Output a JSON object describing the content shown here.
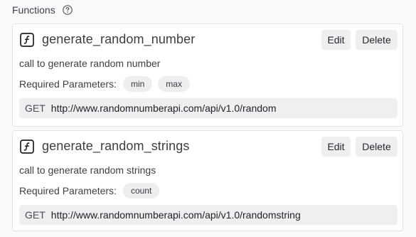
{
  "section": {
    "title": "Functions",
    "help_icon": "question-circle-icon"
  },
  "functions": [
    {
      "icon": "function-icon",
      "name": "generate_random_number",
      "edit_label": "Edit",
      "delete_label": "Delete",
      "description": "call to generate random number",
      "params_label": "Required Parameters:",
      "params": [
        "min",
        "max"
      ],
      "method": "GET",
      "url": "http://www.randomnumberapi.com/api/v1.0/random"
    },
    {
      "icon": "function-icon",
      "name": "generate_random_strings",
      "edit_label": "Edit",
      "delete_label": "Delete",
      "description": "call to generate random strings",
      "params_label": "Required Parameters:",
      "params": [
        "count"
      ],
      "method": "GET",
      "url": "http://www.randomnumberapi.com/api/v1.0/randomstring"
    }
  ]
}
